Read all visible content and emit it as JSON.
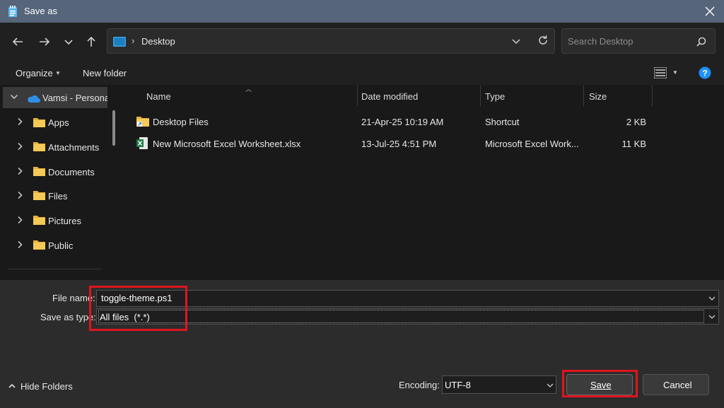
{
  "window": {
    "title": "Save as",
    "icons": {
      "app": "notepad-icon",
      "close": "close-icon"
    }
  },
  "addressbar": {
    "location": "Desktop",
    "separator": "›",
    "search_placeholder": "Search Desktop"
  },
  "toolbar": {
    "organize_label": "Organize",
    "new_folder_label": "New folder"
  },
  "nav": {
    "items": [
      {
        "label": "Vamsi - Personal",
        "icon": "onedrive-icon",
        "expanded": true,
        "selected": true
      },
      {
        "label": "Apps",
        "icon": "folder-icon"
      },
      {
        "label": "Attachments",
        "icon": "folder-icon"
      },
      {
        "label": "Documents",
        "icon": "folder-icon"
      },
      {
        "label": "Files",
        "icon": "folder-icon"
      },
      {
        "label": "Pictures",
        "icon": "folder-icon"
      },
      {
        "label": "Public",
        "icon": "folder-icon"
      }
    ]
  },
  "files": {
    "columns": [
      "Name",
      "Date modified",
      "Type",
      "Size"
    ],
    "rows": [
      {
        "name": "Desktop Files",
        "date": "21-Apr-25 10:19 AM",
        "type": "Shortcut",
        "size": "2 KB",
        "icon": "folder-shortcut-icon"
      },
      {
        "name": "New Microsoft Excel Worksheet.xlsx",
        "date": "13-Jul-25 4:51 PM",
        "type": "Microsoft Excel Work...",
        "size": "11 KB",
        "icon": "excel-file-icon"
      }
    ]
  },
  "form": {
    "filename_label": "File name:",
    "filename_value": "toggle-theme.ps1",
    "type_label": "Save as type:",
    "type_value": "All files  (*.*)",
    "encoding_label": "Encoding:",
    "encoding_value": "UTF-8",
    "hide_folders_label": "Hide Folders",
    "save_label": "Save",
    "cancel_label": "Cancel"
  },
  "colors": {
    "titlebar": "#56657a",
    "highlight": "#e0141e",
    "folder": "#f0c04a",
    "accent": "#1e90ff"
  }
}
